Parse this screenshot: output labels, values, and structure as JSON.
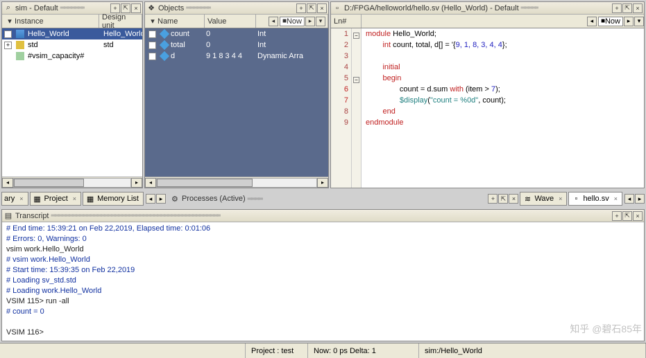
{
  "sim_panel": {
    "title": "sim - Default",
    "col_instance": "Instance",
    "col_design": "Design unit",
    "rows": [
      {
        "exp": "−",
        "name": "Hello_World",
        "unit": "Hello_World",
        "sel": true,
        "indent": 0
      },
      {
        "exp": "+",
        "name": "std",
        "unit": "std",
        "sel": false,
        "indent": 0
      },
      {
        "exp": "",
        "name": "#vsim_capacity#",
        "unit": "",
        "sel": false,
        "indent": 1
      }
    ]
  },
  "objects_panel": {
    "title": "Objects",
    "col_name": "Name",
    "col_value": "Value",
    "now_label": "Now",
    "rows": [
      {
        "exp": "+",
        "name": "count",
        "value": "0",
        "kind": "Int"
      },
      {
        "exp": "+",
        "name": "total",
        "value": "0",
        "kind": "Int"
      },
      {
        "exp": "+",
        "name": "d",
        "value": "9 1 8 3 4 4",
        "kind": "Dynamic Arra"
      }
    ]
  },
  "source_panel": {
    "title": "D:/FPGA/helloworld/hello.sv (Hello_World) - Default",
    "ln_header": "Ln#",
    "now_label": "Now",
    "lines": [
      {
        "n": "1",
        "red": false
      },
      {
        "n": "2",
        "red": false
      },
      {
        "n": "3",
        "red": false
      },
      {
        "n": "4",
        "red": false
      },
      {
        "n": "5",
        "red": false
      },
      {
        "n": "6",
        "red": true
      },
      {
        "n": "7",
        "red": true
      },
      {
        "n": "8",
        "red": false
      },
      {
        "n": "9",
        "red": false
      }
    ],
    "code_tokens": {
      "l1_kw": "module",
      "l1_id": " Hello_World;",
      "l2_kw": "int",
      "l2_rest": " count, total, d[] = '{",
      "l2_nums": "9, 1, 8, 3, 4, 4",
      "l2_end": "};",
      "l4_kw": "initial",
      "l5_kw": "begin",
      "l6_a": "count = d.sum ",
      "l6_kw": "with",
      "l6_b": " (item > ",
      "l6_n": "7",
      "l6_c": ");",
      "l7_sys": "$display",
      "l7_a": "(",
      "l7_str": "\"count = %0d\"",
      "l7_b": ", count);",
      "l8_kw": "end",
      "l9_kw": "endmodule"
    }
  },
  "processes_panel": {
    "title": "Processes (Active)"
  },
  "tabs": {
    "left": [
      {
        "label": "ary",
        "icon": "▦"
      },
      {
        "label": "Project",
        "icon": "▦"
      },
      {
        "label": "Memory List",
        "icon": "▦"
      }
    ],
    "right": [
      {
        "label": "Wave",
        "icon": "≋"
      },
      {
        "label": "hello.sv",
        "icon": "▫"
      }
    ]
  },
  "transcript": {
    "title": "Transcript",
    "lines": [
      {
        "cls": "t-cm",
        "text": "# End time: 15:39:21 on Feb 22,2019, Elapsed time: 0:01:06"
      },
      {
        "cls": "t-cm",
        "text": "# Errors: 0, Warnings: 0"
      },
      {
        "cls": "t-pl",
        "text": "vsim work.Hello_World"
      },
      {
        "cls": "t-cm",
        "text": "# vsim work.Hello_World "
      },
      {
        "cls": "t-cm",
        "text": "# Start time: 15:39:35 on Feb 22,2019"
      },
      {
        "cls": "t-cm",
        "text": "# Loading sv_std.std"
      },
      {
        "cls": "t-cm",
        "text": "# Loading work.Hello_World"
      },
      {
        "cls": "t-pl",
        "text": "VSIM 115> run -all"
      },
      {
        "cls": "t-cm",
        "text": "# count = 0"
      },
      {
        "cls": "t-pl",
        "text": " "
      },
      {
        "cls": "t-pl",
        "text": "VSIM 116> "
      }
    ]
  },
  "status": {
    "project": "Project : test",
    "now": "Now: 0 ps  Delta: 1",
    "scope": "sim:/Hello_World"
  },
  "watermark": "知乎 @碧石85年"
}
